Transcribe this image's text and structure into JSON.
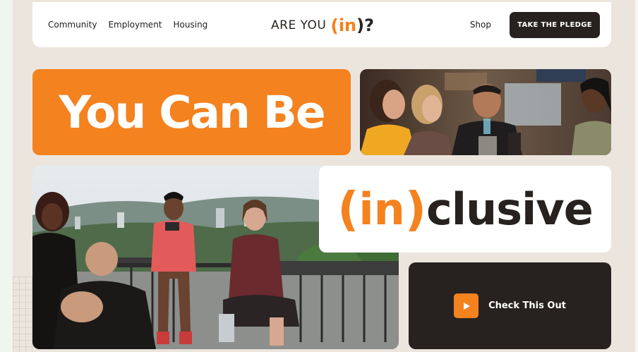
{
  "nav": {
    "links": [
      "Community",
      "Employment",
      "Housing"
    ],
    "logo": {
      "text": "ARE YOU",
      "open_paren": "(",
      "highlight": "in",
      "close": ")?"
    },
    "shop_label": "Shop",
    "pledge_label": "TAKE THE PLEDGE"
  },
  "hero": {
    "headline": "You Can Be",
    "inclusive": {
      "open_paren": "(",
      "highlight": "in",
      "close_paren": ")",
      "rest": "clusive"
    }
  },
  "cta": {
    "label": "Check This Out",
    "icon": "play-icon"
  },
  "colors": {
    "brand_orange": "#f4821f",
    "dark": "#27221f",
    "background": "#ece5de",
    "white": "#ffffff"
  }
}
